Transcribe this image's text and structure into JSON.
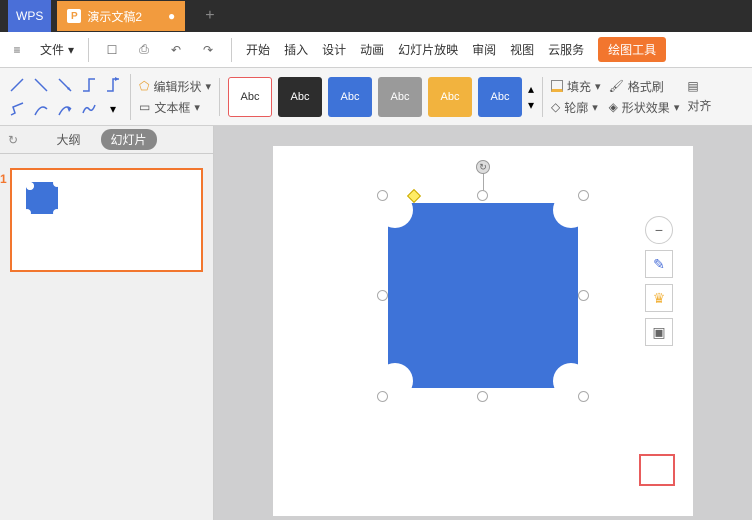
{
  "titlebar": {
    "logo": "WPS",
    "tab_label": "演示文稿2",
    "tab_icon": "P"
  },
  "menubar": {
    "file": "文件",
    "items": [
      "开始",
      "插入",
      "设计",
      "动画",
      "幻灯片放映",
      "审阅",
      "视图",
      "云服务",
      "绘图工具"
    ]
  },
  "toolbar": {
    "edit_shape": "编辑形状",
    "text_box": "文本框",
    "styles": [
      "Abc",
      "Abc",
      "Abc",
      "Abc",
      "Abc",
      "Abc"
    ],
    "fill": "填充",
    "outline": "轮廓",
    "format_painter": "格式刷",
    "shape_effects": "形状效果",
    "align": "对齐"
  },
  "sidebar": {
    "tab_outline": "大纲",
    "tab_slides": "幻灯片",
    "slide_num": "1"
  },
  "float_tools": {
    "minus": "−",
    "pen": "✎",
    "crown": "♛",
    "layers": "▣"
  },
  "rotate": "↻"
}
